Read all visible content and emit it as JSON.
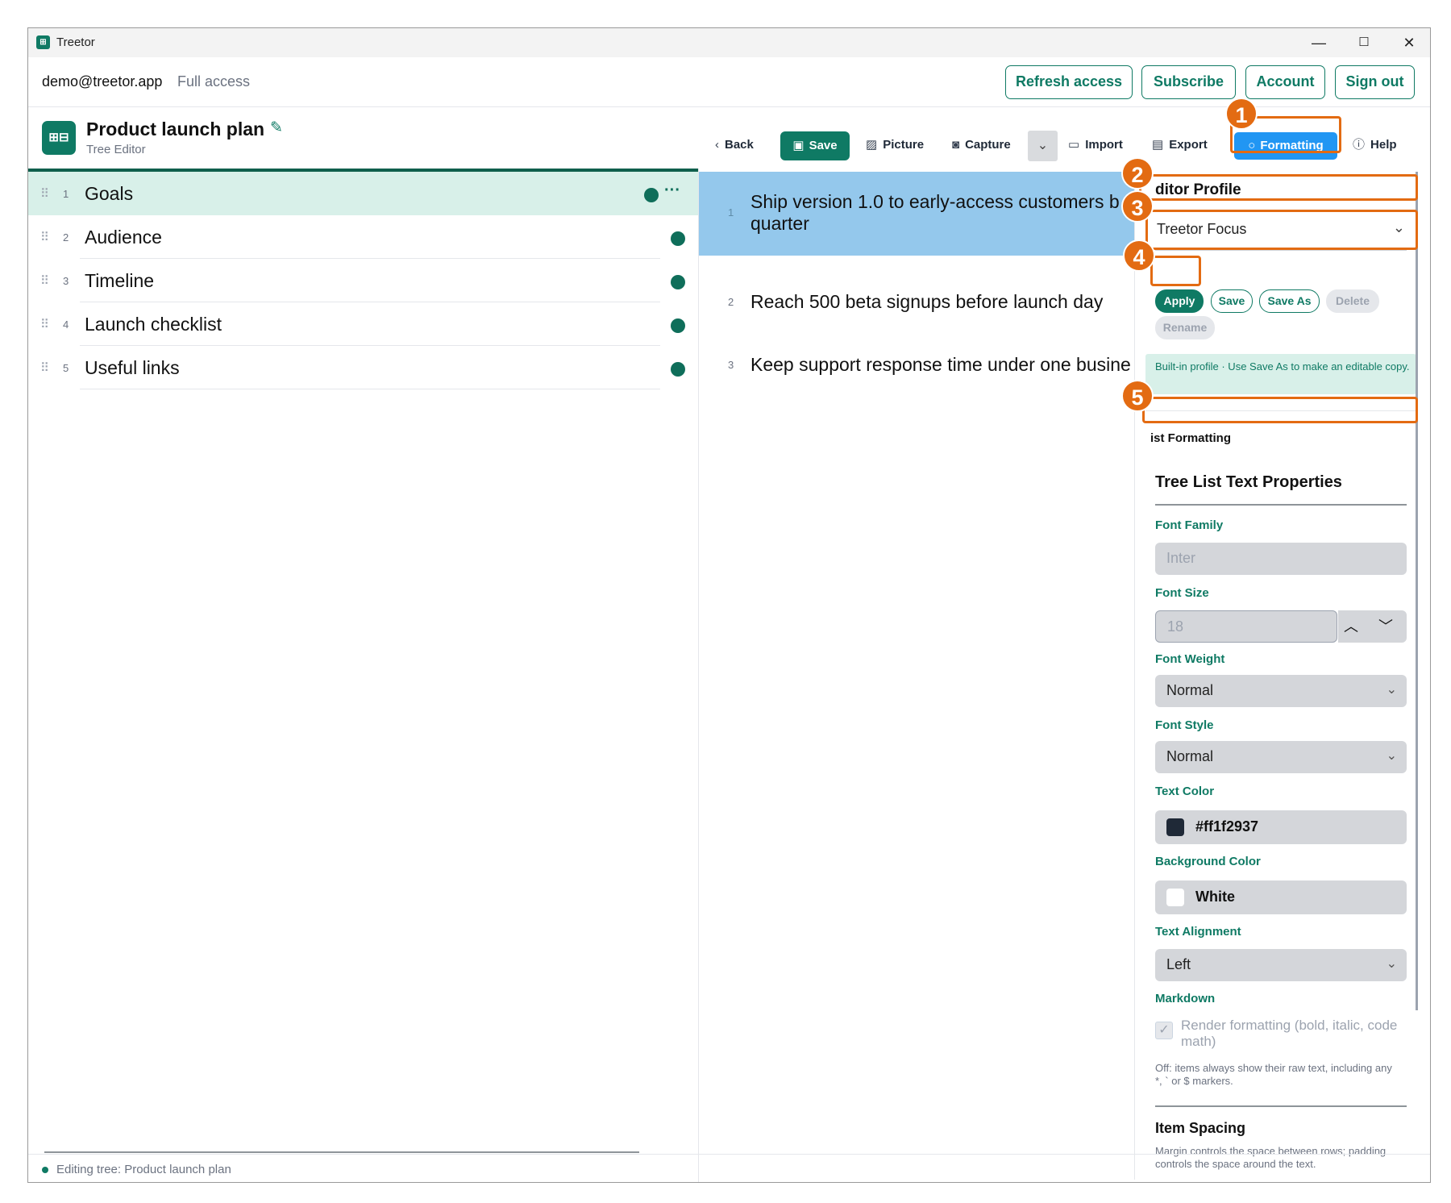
{
  "window": {
    "title": "Treetor",
    "icon": "treetor-app-icon",
    "controls": [
      "—",
      "☐",
      "✕"
    ]
  },
  "account": {
    "email": "demo@treetor.app",
    "access": "Full access",
    "buttons": [
      "Refresh access",
      "Subscribe",
      "Account",
      "Sign out"
    ]
  },
  "document": {
    "title": "Product launch plan",
    "subtitle": "Tree Editor"
  },
  "toolbar": {
    "back": "Back",
    "save": "Save",
    "picture": "Picture",
    "capture": "Capture",
    "import": "Import",
    "export": "Export",
    "formatting": "Formatting",
    "help": "Help"
  },
  "tree": [
    {
      "num": "1",
      "label": "Goals"
    },
    {
      "num": "2",
      "label": "Audience"
    },
    {
      "num": "3",
      "label": "Timeline"
    },
    {
      "num": "4",
      "label": "Launch checklist"
    },
    {
      "num": "5",
      "label": "Useful links"
    }
  ],
  "tree_more": "···",
  "items": [
    {
      "num": "1",
      "text": "Ship version 1.0 to early-access customers b",
      "text2": "quarter"
    },
    {
      "num": "2",
      "text": "Reach 500 beta signups before launch day"
    },
    {
      "num": "3",
      "text": "Keep support response time under one busine"
    }
  ],
  "sidebar": {
    "profile_header": "ditor Profile",
    "profile_value": "Treetor Focus",
    "profile_buttons": {
      "apply": "Apply",
      "save": "Save",
      "save_as": "Save As",
      "delete": "Delete",
      "rename": "Rename"
    },
    "builtin_note": "Built-in profile · Use Save As to make an editable copy.",
    "list_formatting": "ist Formatting",
    "section_title": "Tree List Text Properties",
    "font_family_label": "Font Family",
    "font_family_value": "Inter",
    "font_size_label": "Font Size",
    "font_size_value": "18",
    "font_weight_label": "Font Weight",
    "font_weight_value": "Normal",
    "font_style_label": "Font Style",
    "font_style_value": "Normal",
    "text_color_label": "Text Color",
    "text_color_value": "#ff1f2937",
    "text_color_swatch": "#1f2937",
    "bg_color_label": "Background Color",
    "bg_color_value": "White",
    "bg_color_swatch": "#ffffff",
    "alignment_label": "Text Alignment",
    "alignment_value": "Left",
    "markdown_label": "Markdown",
    "markdown_checkbox_text1": "Render formatting (bold, italic, code",
    "markdown_checkbox_text2": "math)",
    "markdown_checked": true,
    "markdown_note1": "Off: items always show their raw text, including any",
    "markdown_note2": "*, ` or $ markers.",
    "spacing_title": "Item Spacing",
    "spacing_note1": "Margin controls the space between rows; padding",
    "spacing_note2": "controls the space around the text."
  },
  "callouts": [
    "1",
    "2",
    "3",
    "4",
    "5"
  ],
  "status": "Editing tree: Product launch plan",
  "colors": {
    "accent": "#0f7a64",
    "highlight": "#2196f3",
    "callout": "#e36b12",
    "selected_row": "#d8f0e9",
    "selected_item": "#94c8ec"
  }
}
